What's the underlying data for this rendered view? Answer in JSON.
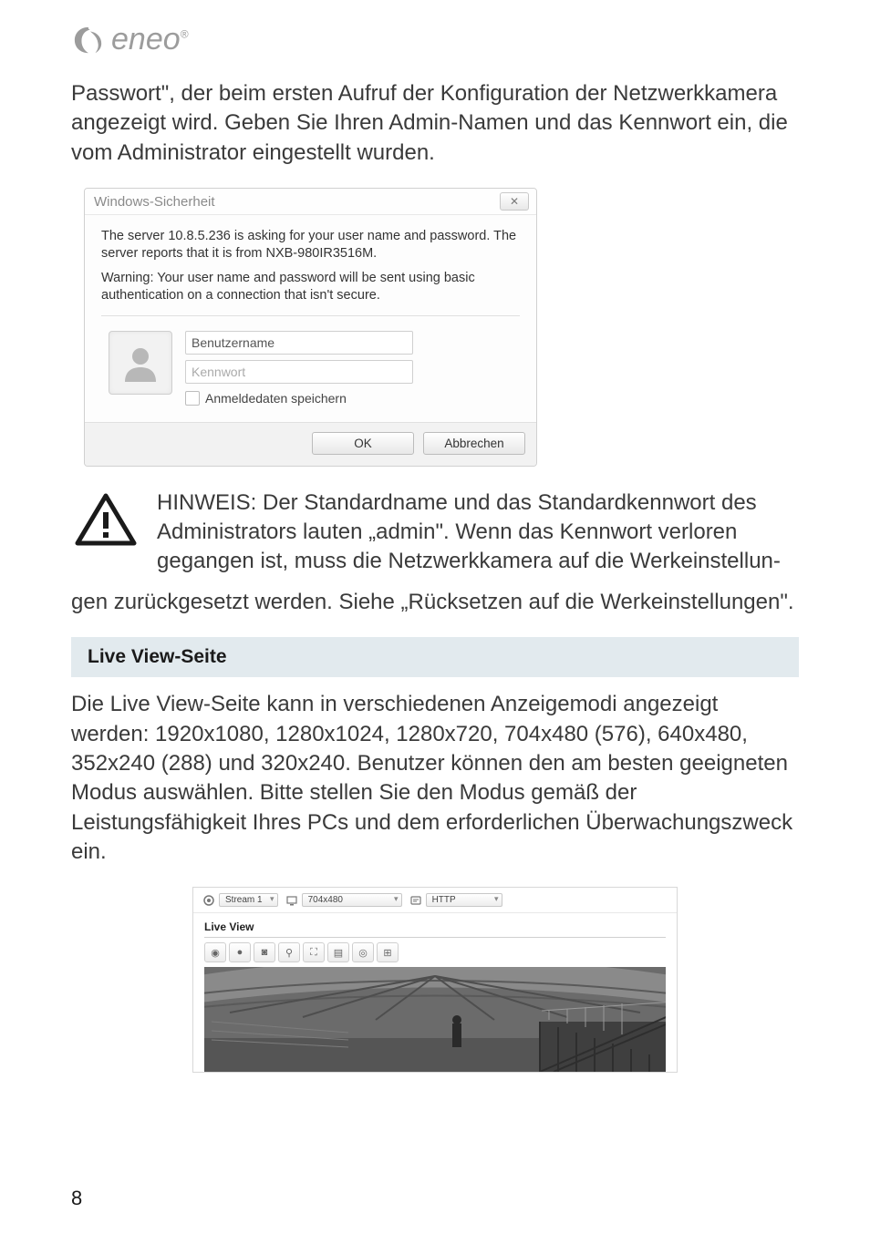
{
  "logo": {
    "text": "eneo"
  },
  "intro_paragraph": "Passwort\", der beim ersten Aufruf der Konfiguration der Netzwerkkamera angezeigt wird. Geben Sie Ihren Admin-Namen und das Kennwort ein, die vom Administrator eingestellt wurden.",
  "dialog": {
    "title": "Windows-Sicherheit",
    "message1": "The server 10.8.5.236 is asking for your user name and password. The server reports that it is from NXB-980IR3516M.",
    "message2": "Warning: Your user name and password will be sent using basic authentication on a connection that isn't secure.",
    "username_placeholder": "Benutzername",
    "password_placeholder": "Kennwort",
    "remember_label": "Anmeldedaten speichern",
    "ok_label": "OK",
    "cancel_label": "Abbrechen"
  },
  "notice": {
    "line1": "HINWEIS: Der Standardname und das Standardkennwort des Administrators lauten „admin\". Wenn das Kennwort verloren gegangen ist, muss die Netzwerkkamera auf die Werkeinstellun-",
    "line2": "gen zurückgesetzt werden. Siehe „Rücksetzen auf die Werkeinstellungen\"."
  },
  "section_title": "Live View-Seite",
  "liveview_paragraph": "Die Live View-Seite kann in verschiedenen Anzeigemodi angezeigt werden: 1920x1080, 1280x1024, 1280x720, 704x480 (576), 640x480, 352x240 (288) und 320x240. Benutzer können den am besten geeigneten Modus auswählen. Bitte stellen Sie den Modus gemäß der Leistungsfähigkeit Ihres PCs und dem erforderlichen Überwachungszweck ein.",
  "liveview_ui": {
    "stream_label": "Stream 1",
    "resolution_label": "704x480",
    "protocol_label": "HTTP",
    "panel_title": "Live View"
  },
  "page_number": "8"
}
